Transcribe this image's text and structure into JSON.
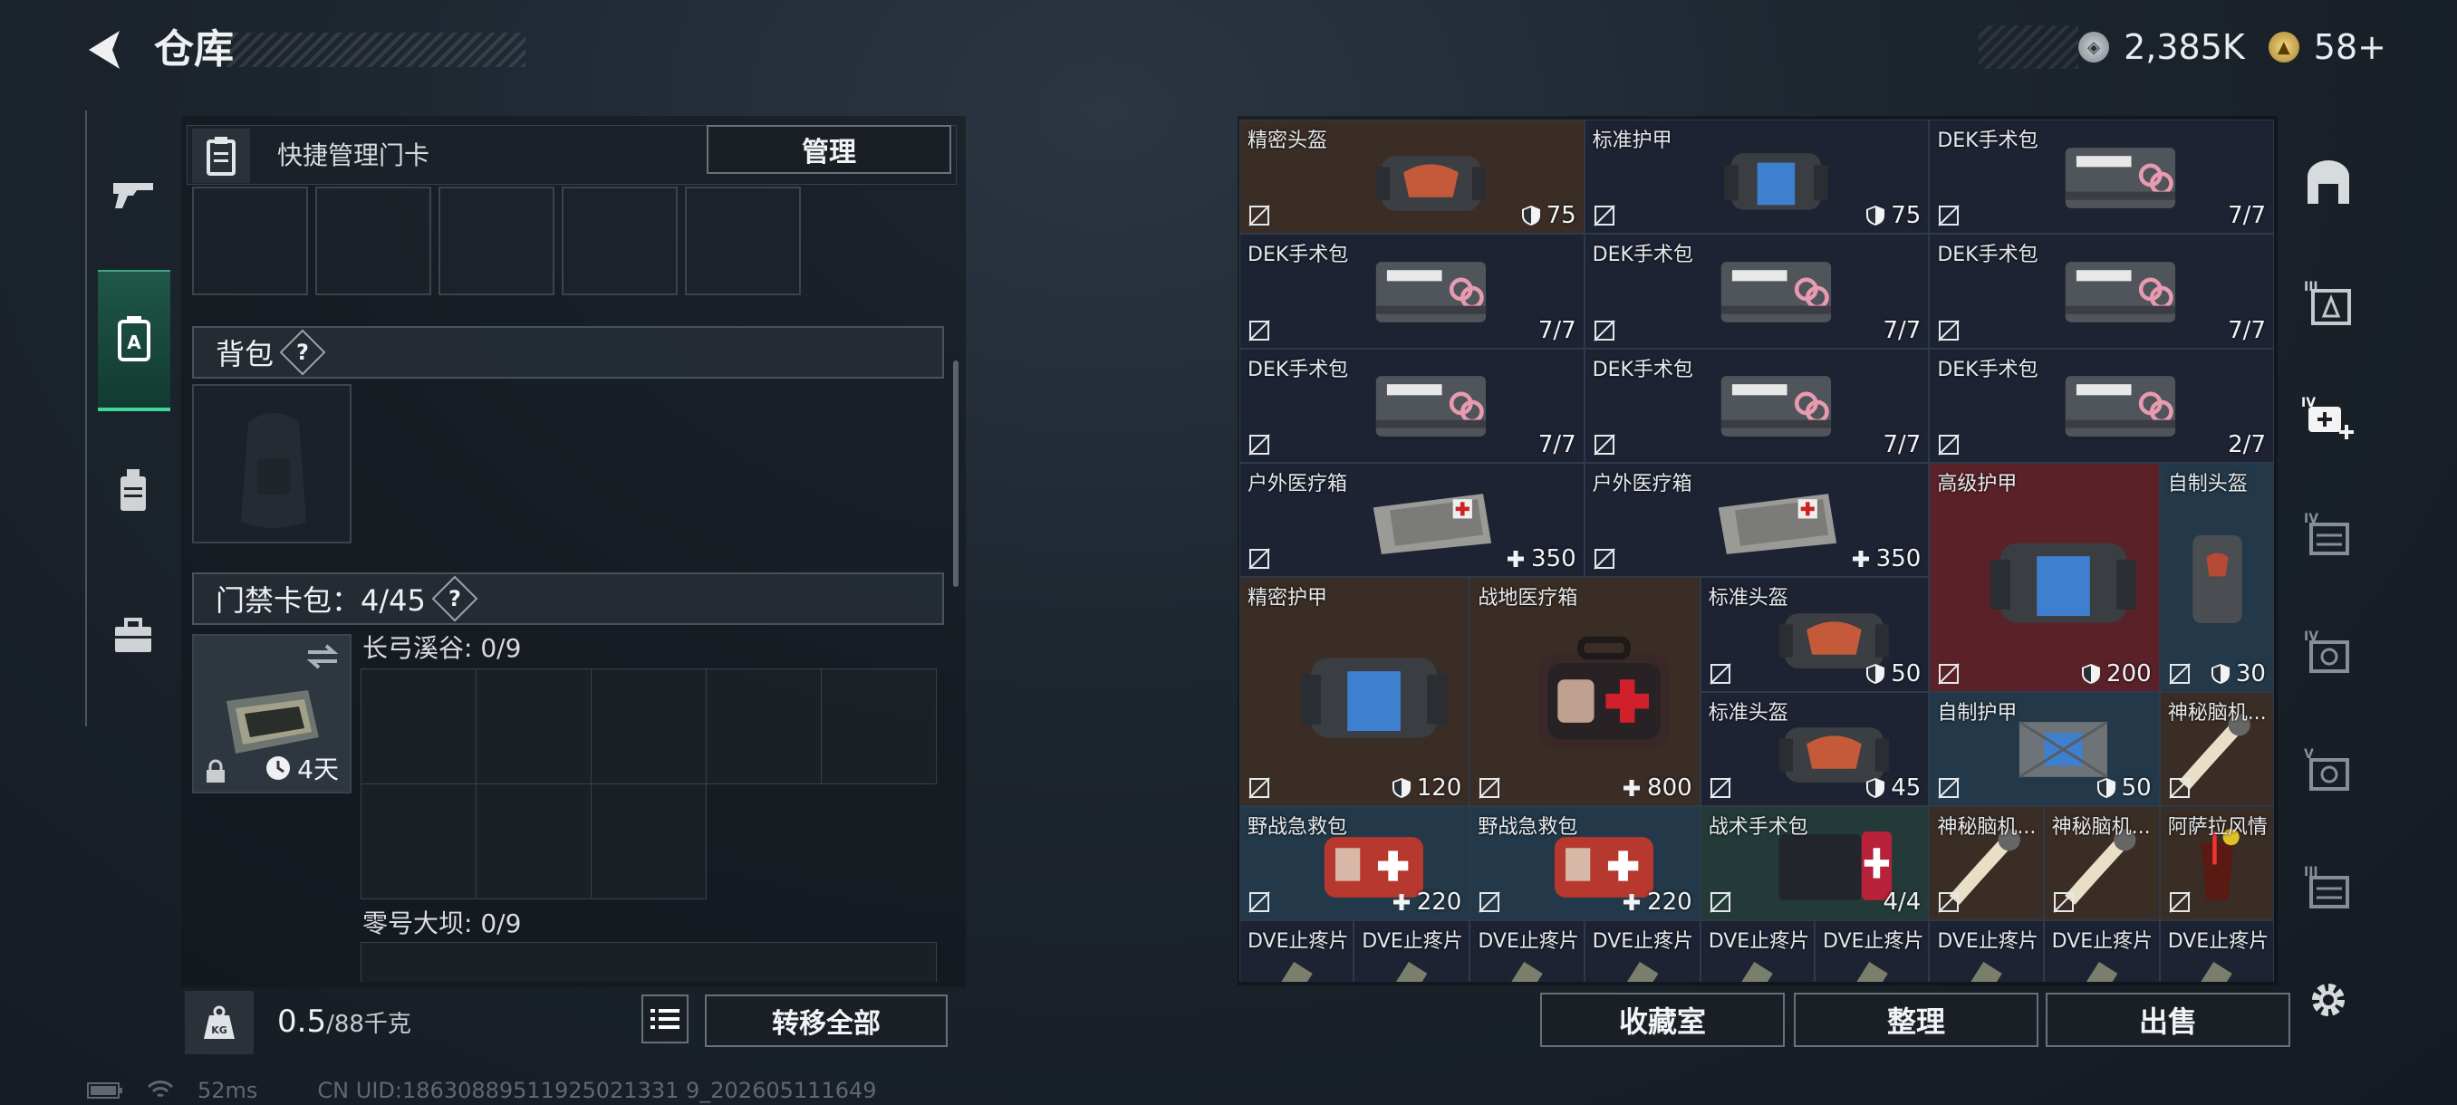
{
  "header": {
    "title": "仓库"
  },
  "currency": [
    {
      "icon": "silver-coin-icon",
      "value": "2,385K"
    },
    {
      "icon": "gold-coin-icon",
      "value": "58+"
    }
  ],
  "left_nav": [
    "gun-icon",
    "backpack-card-icon",
    "backpack-icon",
    "toolbox-icon"
  ],
  "quick_card": {
    "label": "快捷管理门卡",
    "manage_button": "管理"
  },
  "backpack": {
    "title": "背包",
    "help": "?"
  },
  "card_pack": {
    "title": "门禁卡包：4/45",
    "help": "?",
    "timer": "4天",
    "maps": [
      {
        "name": "长弓溪谷: 0/9"
      },
      {
        "name": "零号大坝: 0/9"
      }
    ]
  },
  "weight": {
    "value": "0.5",
    "max": "/88千克"
  },
  "transfer_all_button": "转移全部",
  "inventory": [
    {
      "name": "精密头盔",
      "value": "75",
      "badge": "shield"
    },
    {
      "name": "标准护甲",
      "value": "75",
      "badge": "shield"
    },
    {
      "name": "DEK手术包",
      "value": "7/7"
    },
    {
      "name": "DEK手术包",
      "value": "7/7"
    },
    {
      "name": "DEK手术包",
      "value": "7/7"
    },
    {
      "name": "DEK手术包",
      "value": "7/7"
    },
    {
      "name": "DEK手术包",
      "value": "7/7"
    },
    {
      "name": "DEK手术包",
      "value": "7/7"
    },
    {
      "name": "DEK手术包",
      "value": "2/7"
    },
    {
      "name": "户外医疗箱",
      "value": "350",
      "badge": "plus"
    },
    {
      "name": "户外医疗箱",
      "value": "350",
      "badge": "plus"
    },
    {
      "name": "高级护甲",
      "value": "200",
      "badge": "shield"
    },
    {
      "name": "自制头盔",
      "value": "30",
      "badge": "shield"
    },
    {
      "name": "精密护甲",
      "value": "120",
      "badge": "shield"
    },
    {
      "name": "战地医疗箱",
      "value": "800",
      "badge": "plus"
    },
    {
      "name": "标准头盔",
      "value": "50",
      "badge": "shield"
    },
    {
      "name": "标准头盔",
      "value": "45",
      "badge": "shield"
    },
    {
      "name": "自制护甲",
      "value": "50",
      "badge": "shield"
    },
    {
      "name": "神秘脑机...",
      "value": ""
    },
    {
      "name": "野战急救包",
      "value": "220",
      "badge": "plus"
    },
    {
      "name": "野战急救包",
      "value": "220",
      "badge": "plus"
    },
    {
      "name": "战术手术包",
      "value": "4/4"
    },
    {
      "name": "神秘脑机...",
      "value": ""
    },
    {
      "name": "神秘脑机...",
      "value": ""
    },
    {
      "name": "阿萨拉风情",
      "value": ""
    },
    {
      "name": "DVE止疼片",
      "value": ""
    },
    {
      "name": "DVE止疼片",
      "value": ""
    },
    {
      "name": "DVE止疼片",
      "value": ""
    },
    {
      "name": "DVE止疼片",
      "value": ""
    },
    {
      "name": "DVE止疼片",
      "value": ""
    },
    {
      "name": "DVE止疼片",
      "value": ""
    },
    {
      "name": "DVE止疼片",
      "value": ""
    },
    {
      "name": "DVE止疼片",
      "value": ""
    },
    {
      "name": "DVE止疼片",
      "value": ""
    }
  ],
  "actions": {
    "collection": "收藏室",
    "sort": "整理",
    "sell": "出售"
  },
  "right_nav": [
    "safe-box-icon",
    "tier3-armor-icon",
    "tier4-medkit-add-icon",
    "tier4-bag-icon",
    "tier4-gear-icon",
    "tier5-gear-icon",
    "tier3-misc-icon",
    "settings-icon"
  ],
  "footer": {
    "ping": "52ms",
    "uid": "CN UID:18630889511925021331 9_202605111649"
  }
}
